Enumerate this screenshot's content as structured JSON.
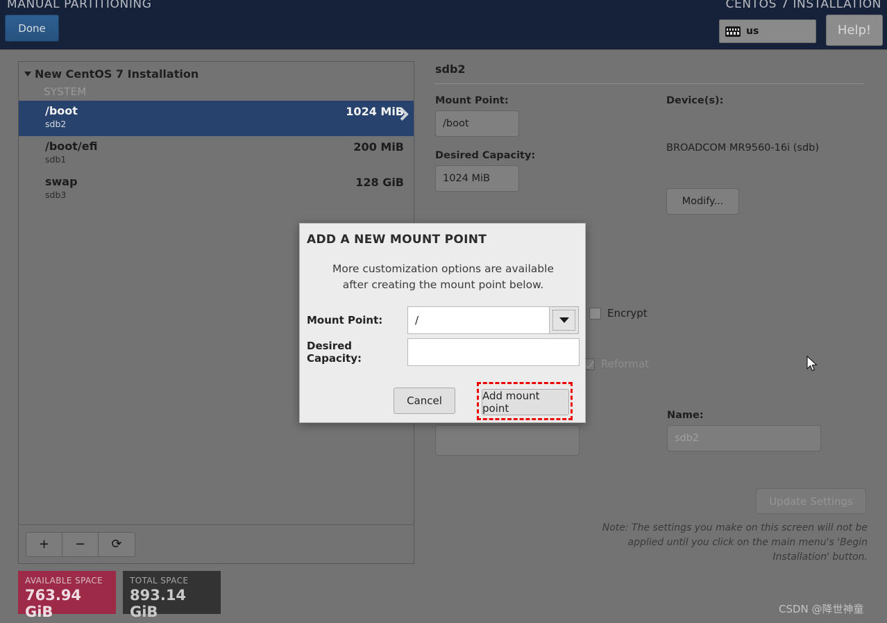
{
  "header": {
    "screen_title": "MANUAL PARTITIONING",
    "product_title": "CENTOS 7 INSTALLATION",
    "done_label": "Done",
    "keyboard_icon": "keyboard-icon",
    "keyboard_layout": "us",
    "help_label": "Help!",
    "bg_color": "#16213a",
    "done_color": "#2e5f91"
  },
  "left_panel": {
    "group": {
      "label": "New CentOS 7 Installation",
      "expanded": true,
      "subheading": "SYSTEM"
    },
    "partitions": [
      {
        "mount": "/boot",
        "device": "sdb2",
        "size": "1024 MiB",
        "selected": true
      },
      {
        "mount": "/boot/efi",
        "device": "sdb1",
        "size": "200 MiB",
        "selected": false
      },
      {
        "mount": "swap",
        "device": "sdb3",
        "size": "128 GiB",
        "selected": false
      }
    ],
    "toolbar": {
      "add_label": "+",
      "remove_label": "−",
      "refresh_label": "⟳"
    },
    "selected_row_color": "#27436d"
  },
  "space": {
    "available_label": "AVAILABLE SPACE",
    "available_value": "763.94 GiB",
    "available_color": "#9d2b48",
    "total_label": "TOTAL SPACE",
    "total_value": "893.14 GiB",
    "total_color": "#333333"
  },
  "right_panel": {
    "title": "sdb2",
    "mount_point_label": "Mount Point:",
    "mount_point_value": "/boot",
    "desired_capacity_label": "Desired Capacity:",
    "desired_capacity_value": "1024 MiB",
    "devices_label": "Device(s):",
    "device_value": "BROADCOM MR9560-16i (sdb)",
    "modify_label": "Modify...",
    "encrypt_label": "Encrypt",
    "encrypt_checked": false,
    "reformat_label": "Reformat",
    "reformat_checked": true,
    "name_label": "Name:",
    "name_value": "sdb2",
    "update_settings_label": "Update Settings",
    "note": "Note:  The settings you make on this screen will not be applied until you click on the main menu's 'Begin Installation' button."
  },
  "dialog": {
    "title": "ADD A NEW MOUNT POINT",
    "subtitle_line1": "More customization options are available",
    "subtitle_line2": "after creating the mount point below.",
    "mount_point_label": "Mount Point:",
    "mount_point_value": "/",
    "dropdown_icon": "chevron-down-icon",
    "desired_capacity_label": "Desired Capacity:",
    "desired_capacity_value": "",
    "desired_capacity_placeholder": "",
    "cancel_label": "Cancel",
    "add_label": "Add mount point",
    "highlight_color": "#ef0000"
  },
  "watermark": "CSDN @降世神童"
}
